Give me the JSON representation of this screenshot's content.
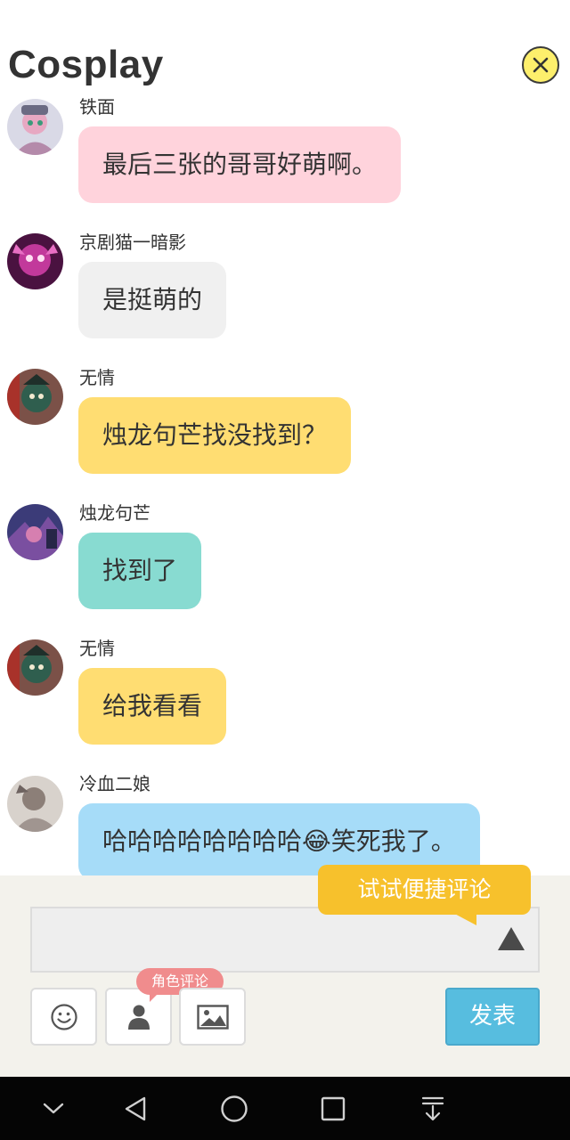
{
  "header": {
    "title": "Cosplay",
    "close_icon": "close-circle-icon"
  },
  "messages": [
    {
      "user": "铁面",
      "text": "最后三张的哥哥好萌啊。",
      "color": "#ffd3dc"
    },
    {
      "user": "京剧猫一暗影",
      "text": "是挺萌的",
      "color": "#f0f0f0"
    },
    {
      "user": "无情",
      "text": "烛龙句芒找没找到？",
      "color": "#ffdd72"
    },
    {
      "user": "烛龙句芒",
      "text": "找到了",
      "color": "#88dbd1"
    },
    {
      "user": "无情",
      "text": "给我看看",
      "color": "#ffdd72"
    },
    {
      "user": "冷血二娘",
      "text": "哈哈哈哈哈哈哈哈😂笑死我了。",
      "color": "#a6dcf8"
    }
  ],
  "composer": {
    "tip": "试试便捷评论",
    "role_tag": "角色评论",
    "send_label": "发表",
    "tools": [
      "smiley-icon",
      "person-icon",
      "image-icon"
    ]
  },
  "navbar": {
    "icons": [
      "chevron-down-icon",
      "back-triangle-icon",
      "home-circle-icon",
      "recents-square-icon",
      "notification-pull-icon"
    ]
  },
  "colors": {
    "accent": "#57bddf",
    "tip": "#f7c12c",
    "role_tag": "#f08c8d",
    "close_bg": "#fdef6c"
  }
}
